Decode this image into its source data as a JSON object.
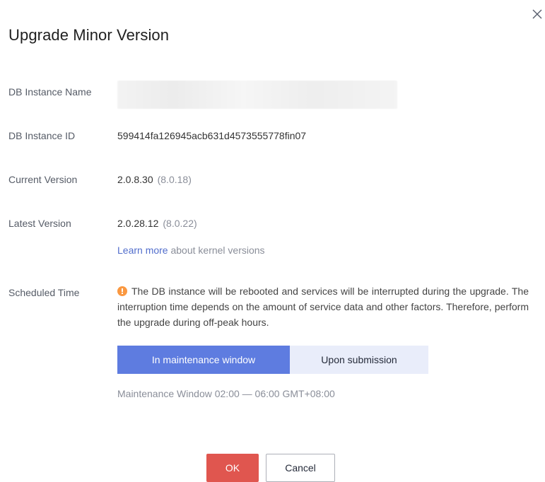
{
  "dialog": {
    "title": "Upgrade Minor Version",
    "close_icon": "close-icon"
  },
  "fields": {
    "instance_name_label": "DB Instance Name",
    "instance_name_value": "",
    "instance_id_label": "DB Instance ID",
    "instance_id_value": "599414fa126945acb631d4573555778fin07",
    "current_version_label": "Current Version",
    "current_version_value": "2.0.8.30",
    "current_version_sub": "(8.0.18)",
    "latest_version_label": "Latest Version",
    "latest_version_value": "2.0.28.12",
    "latest_version_sub": "(8.0.22)",
    "learn_more_link": "Learn more",
    "learn_more_suffix": "about kernel versions",
    "scheduled_time_label": "Scheduled Time"
  },
  "warning": {
    "icon": "warning-icon",
    "color": "#fa9841",
    "text": "The DB instance will be rebooted and services will be interrupted during the upgrade. The interruption time depends on the amount of service data and other factors. Therefore, perform the upgrade during off-peak hours."
  },
  "schedule": {
    "options": [
      "In maintenance window",
      "Upon submission"
    ],
    "selected": "In maintenance window",
    "maintenance_window_text": "Maintenance Window 02:00 — 06:00 GMT+08:00"
  },
  "buttons": {
    "ok": "OK",
    "cancel": "Cancel"
  },
  "colors": {
    "primary": "#5e7ce0",
    "danger": "#e0564f",
    "link": "#526ecc"
  }
}
